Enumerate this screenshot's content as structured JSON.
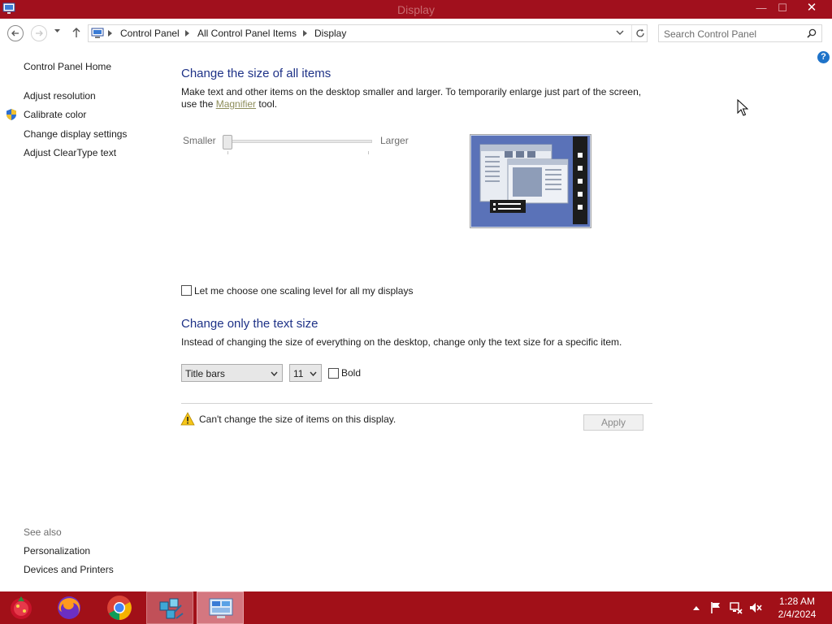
{
  "window": {
    "title": "Display",
    "minimize_glyph": "—",
    "maximize_glyph": "☐",
    "close_glyph": "✕"
  },
  "address": {
    "crumbs": [
      "Control Panel",
      "All Control Panel Items",
      "Display"
    ],
    "search_placeholder": "Search Control Panel"
  },
  "sidebar": {
    "home": "Control Panel Home",
    "items": [
      {
        "label": "Adjust resolution",
        "icon": "none"
      },
      {
        "label": "Calibrate color",
        "icon": "shield-icon"
      },
      {
        "label": "Change display settings",
        "icon": "none"
      },
      {
        "label": "Adjust ClearType text",
        "icon": "none"
      }
    ],
    "see_also_title": "See also",
    "see_also": [
      "Personalization",
      "Devices and Printers"
    ]
  },
  "help_glyph": "?",
  "main": {
    "size_heading": "Change the size of all items",
    "size_desc_line1": "Make text and other items on the desktop smaller and larger. To temporarily enlarge just part of the screen,",
    "size_desc_pre": "use the ",
    "size_desc_link": "Magnifier",
    "size_desc_post": " tool.",
    "slider": {
      "min_label": "Smaller",
      "max_label": "Larger",
      "value": 0
    },
    "one_scaling_checkbox": {
      "label": "Let me choose one scaling level for all my displays",
      "checked": false
    },
    "text_heading": "Change only the text size",
    "text_desc": "Instead of changing the size of everything on the desktop, change only the text size for a specific item.",
    "item_select": "Title bars",
    "size_select": "11",
    "bold_checkbox": {
      "label": "Bold",
      "checked": false
    },
    "warning": "Can't change the size of items on this display.",
    "apply_label": "Apply"
  },
  "taskbar": {
    "apps": [
      "start-orb-icon",
      "firefox-icon",
      "chrome-icon",
      "network-app-icon",
      "control-panel-icon"
    ],
    "time": "1:28 AM",
    "date": "2/4/2024"
  },
  "colors": {
    "titlebar": "#a1101d",
    "taskbar": "#a11018",
    "heading": "#1e3287",
    "link": "#8d8d5a"
  }
}
